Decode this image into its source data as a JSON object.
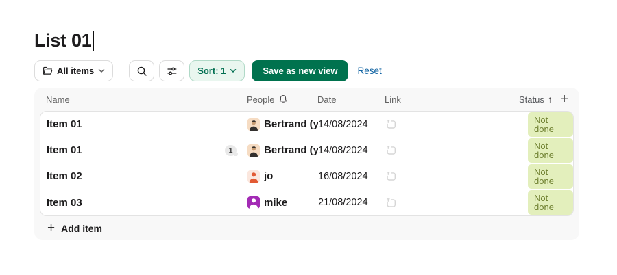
{
  "page": {
    "title": "List 01"
  },
  "toolbar": {
    "view_filter_label": "All items",
    "sort_label": "Sort: 1",
    "save_button_label": "Save as new view",
    "reset_label": "Reset"
  },
  "table": {
    "headers": {
      "name": "Name",
      "people": "People",
      "date": "Date",
      "link": "Link",
      "status": "Status",
      "sort_direction": "↑",
      "add_column": "+"
    },
    "rows": [
      {
        "name": "Item 01",
        "comment_count": "",
        "person": "Bertrand (you)",
        "avatar": "bertrand",
        "date": "14/08/2024",
        "status": "Not done"
      },
      {
        "name": "Item 01",
        "comment_count": "1",
        "person": "Bertrand (you)",
        "avatar": "bertrand",
        "date": "14/08/2024",
        "status": "Not done"
      },
      {
        "name": "Item 02",
        "comment_count": "",
        "person": "jo",
        "avatar": "orange",
        "date": "16/08/2024",
        "status": "Not done"
      },
      {
        "name": "Item 03",
        "comment_count": "",
        "person": "mike",
        "avatar": "purple",
        "date": "21/08/2024",
        "status": "Not done"
      }
    ],
    "add_item_label": "Add item",
    "add_item_plus": "+"
  },
  "colors": {
    "accent_green": "#00724e",
    "link_blue": "#1264a3",
    "status_pill_bg": "#e3efbc",
    "status_pill_text": "#6f8030",
    "sort_button_bg": "#e9f6ef",
    "sort_button_border": "#b0d9c7",
    "sort_button_text": "#006e50",
    "avatar_orange": "#e25a34",
    "avatar_purple": "#a32bb5"
  }
}
